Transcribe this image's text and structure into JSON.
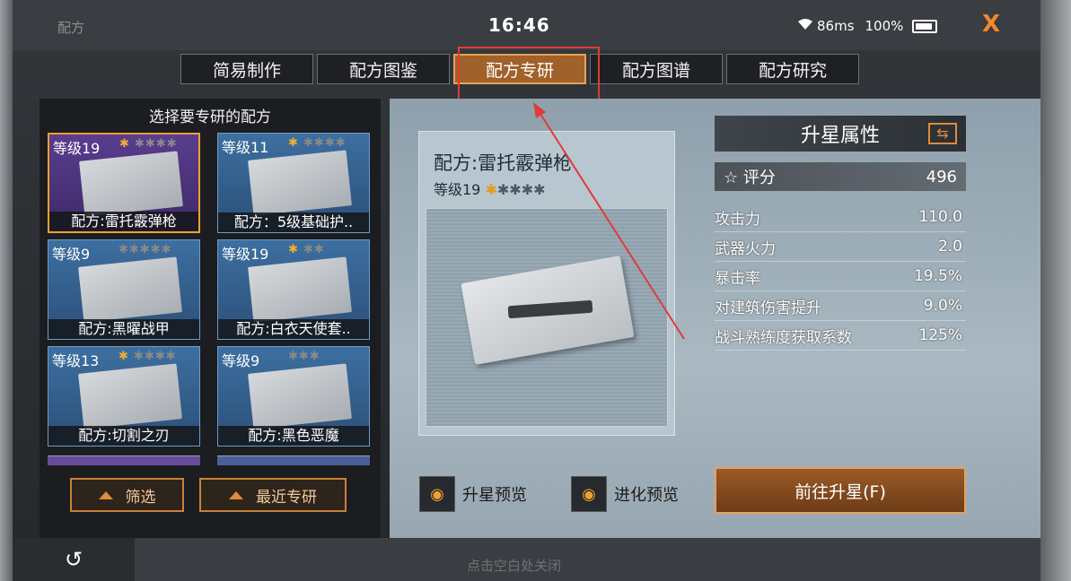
{
  "header": {
    "title": "配方",
    "clock": "16:46",
    "ping": "86ms",
    "battery": "100%",
    "close_label": "X"
  },
  "tabs": [
    {
      "label": "简易制作",
      "active": false
    },
    {
      "label": "配方图鉴",
      "active": false
    },
    {
      "label": "配方专研",
      "active": true
    },
    {
      "label": "配方图谱",
      "active": false
    },
    {
      "label": "配方研究",
      "active": false
    }
  ],
  "left_panel": {
    "title": "选择要专研的配方",
    "cards": [
      {
        "level": "等级19",
        "stars_filled": 1,
        "name": "配方:雷托霰弹枪",
        "selected": true
      },
      {
        "level": "等级11",
        "stars_filled": 1,
        "name": "配方：5级基础护.."
      },
      {
        "level": "等级9",
        "stars_filled": 0,
        "name": "配方:黑曜战甲"
      },
      {
        "level": "等级19",
        "stars_filled": 1,
        "name": "配方:白衣天使套.."
      },
      {
        "level": "等级13",
        "stars_filled": 1,
        "name": "配方:切割之刃"
      },
      {
        "level": "等级9",
        "stars_filled": 0,
        "name": "配方:黑色恶魔"
      }
    ],
    "filter_label": "筛选",
    "recent_label": "最近专研"
  },
  "detail": {
    "title": "配方:雷托霰弹枪",
    "level": "等级19",
    "star_filled": "✱",
    "stars_empty": "✱✱✱✱",
    "upgrade_preview": "升星预览",
    "evolve_preview": "进化预览"
  },
  "attributes": {
    "header": "升星属性",
    "score_label": "评分",
    "score_value": "496",
    "stats": [
      {
        "label": "攻击力",
        "value": "110.0"
      },
      {
        "label": "武器火力",
        "value": "2.0"
      },
      {
        "label": "暴击率",
        "value": "19.5%"
      },
      {
        "label": "对建筑伤害提升",
        "value": "9.0%"
      },
      {
        "label": "战斗熟练度获取系数",
        "value": "125%"
      }
    ],
    "go_button": "前往升星(F)"
  },
  "footer": {
    "hint": "点击空白处关闭",
    "back_icon": "↺"
  }
}
